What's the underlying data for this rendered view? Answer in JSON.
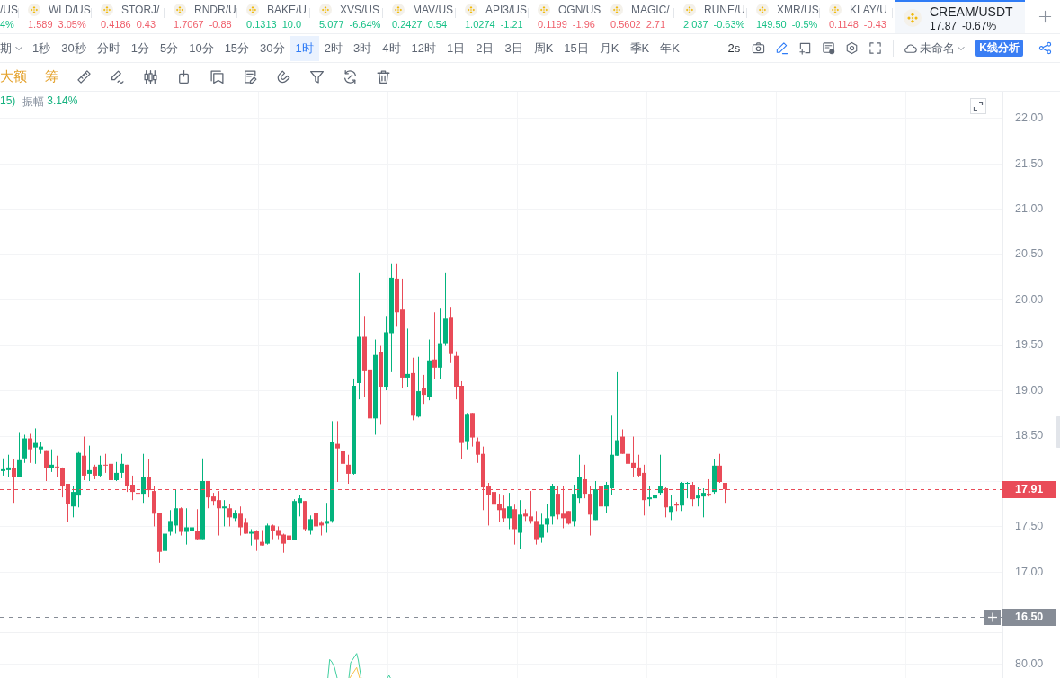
{
  "ticker": {
    "items": [
      {
        "kind": "partial",
        "symbol": "/US",
        "change": "4%",
        "color": "#16c086",
        "selected": false
      },
      {
        "kind": "full",
        "symbol": "WLD/US",
        "price": "1.589",
        "change": "3.05%",
        "color": "#ef5f6b",
        "selected": false
      },
      {
        "kind": "full",
        "symbol": "STORJ/",
        "price": "0.4186",
        "change": "0.43",
        "color": "#ef5f6b",
        "selected": false
      },
      {
        "kind": "full",
        "symbol": "RNDR/U",
        "price": "1.7067",
        "change": "-0.88",
        "color": "#ef5f6b",
        "selected": false
      },
      {
        "kind": "full",
        "symbol": "BAKE/U",
        "price": "0.1313",
        "change": "10.0",
        "color": "#16c086",
        "selected": false
      },
      {
        "kind": "full",
        "symbol": "XVS/US",
        "price": "5.077",
        "change": "-6.64%",
        "color": "#16c086",
        "selected": false
      },
      {
        "kind": "full",
        "symbol": "MAV/US",
        "price": "0.2427",
        "change": "0.54",
        "color": "#16c086",
        "selected": false
      },
      {
        "kind": "full",
        "symbol": "API3/US",
        "price": "1.0274",
        "change": "-1.21",
        "color": "#16c086",
        "selected": false
      },
      {
        "kind": "full",
        "symbol": "OGN/US",
        "price": "0.1199",
        "change": "-1.96",
        "color": "#ef5f6b",
        "selected": false
      },
      {
        "kind": "full",
        "symbol": "MAGIC/",
        "price": "0.5602",
        "change": "2.71",
        "color": "#ef5f6b",
        "selected": false
      },
      {
        "kind": "full",
        "symbol": "RUNE/U",
        "price": "2.037",
        "change": "-0.63%",
        "color": "#16c086",
        "selected": false
      },
      {
        "kind": "full",
        "symbol": "XMR/US",
        "price": "149.50",
        "change": "-0.5%",
        "color": "#16c086",
        "selected": false
      },
      {
        "kind": "full",
        "symbol": "KLAY/U",
        "price": "0.1148",
        "change": "-0.43",
        "color": "#ef5f6b",
        "selected": false
      },
      {
        "kind": "full",
        "symbol": "CREAM/USDT",
        "price": "17.87",
        "change": "-0.67%",
        "selected": true
      }
    ]
  },
  "timeframes": {
    "period": "期",
    "items": [
      {
        "label": "1秒",
        "selected": false
      },
      {
        "label": "30秒",
        "selected": false
      },
      {
        "label": "分时",
        "selected": false
      },
      {
        "label": "1分",
        "selected": false
      },
      {
        "label": "5分",
        "selected": false
      },
      {
        "label": "10分",
        "selected": false
      },
      {
        "label": "15分",
        "selected": false
      },
      {
        "label": "30分",
        "selected": false
      },
      {
        "label": "1时",
        "selected": true
      },
      {
        "label": "2时",
        "selected": false
      },
      {
        "label": "3时",
        "selected": false
      },
      {
        "label": "4时",
        "selected": false
      },
      {
        "label": "12时",
        "selected": false
      },
      {
        "label": "1日",
        "selected": false
      },
      {
        "label": "2日",
        "selected": false
      },
      {
        "label": "3日",
        "selected": false
      },
      {
        "label": "周K",
        "selected": false
      },
      {
        "label": "15日",
        "selected": false
      },
      {
        "label": "月K",
        "selected": false
      },
      {
        "label": "季K",
        "selected": false
      },
      {
        "label": "年K",
        "selected": false
      }
    ]
  },
  "chart_tools": {
    "interval": "2s",
    "layout_name": "未命名",
    "analysis_button": "K线分析"
  },
  "drawing_tools": {
    "buttons": [
      "大额",
      "筹"
    ]
  },
  "legend": {
    "value_tail": "15)",
    "amplitude_label": "振幅",
    "amplitude_value": "3.14%"
  },
  "chart": {
    "chart_data": [
      {
        "type": "candlestick",
        "grid": true,
        "ylim": [
          15.83,
          22.29
        ],
        "yticks": [
          {
            "value": 17,
            "label": "17.00"
          },
          {
            "value": 17.5,
            "label": "17.50"
          },
          {
            "value": 18.5,
            "label": "18.50"
          },
          {
            "value": 19,
            "label": "19.00"
          },
          {
            "value": 19.5,
            "label": "19.50"
          },
          {
            "value": 20,
            "label": "20.00"
          },
          {
            "value": 20.5,
            "label": "20.50"
          },
          {
            "value": 21,
            "label": "21.00"
          },
          {
            "value": 21.5,
            "label": "21.50"
          },
          {
            "value": 22,
            "label": "22.00"
          }
        ],
        "ref_lines": [
          {
            "axis": "y",
            "value": 17.91,
            "label": "17.91",
            "color": "#e94b58",
            "line_style": "dashed"
          },
          {
            "axis": "y",
            "value": 16.5,
            "label": "16.50",
            "color": "#868c96",
            "line_style": "dashed"
          }
        ],
        "categories": [
          null,
          null,
          null,
          null,
          null,
          null,
          null,
          null,
          null,
          null,
          null,
          null,
          null,
          null,
          null,
          null,
          null,
          null,
          null,
          null,
          null,
          null,
          null,
          null,
          null,
          null,
          null,
          null,
          null,
          null,
          null,
          null,
          null,
          null,
          null,
          null,
          null,
          null,
          null,
          null,
          null,
          null,
          null,
          null,
          null,
          null,
          null,
          null,
          null,
          null,
          null,
          null,
          null,
          null,
          null,
          null,
          null,
          null,
          null,
          null,
          null,
          null,
          null,
          null,
          null,
          null,
          null,
          null,
          null,
          null,
          null,
          null,
          null,
          null,
          null,
          null,
          null,
          null,
          null,
          null,
          null,
          null,
          null,
          null,
          null,
          null,
          null,
          null,
          null,
          null,
          null,
          null,
          null,
          null,
          null,
          null,
          null,
          null,
          null,
          null,
          null,
          null,
          null,
          null,
          null,
          null,
          null,
          null,
          null,
          null,
          null,
          null,
          null,
          null,
          null,
          null,
          null,
          null,
          null,
          null,
          null,
          null,
          null,
          null,
          null,
          null,
          null,
          null,
          null,
          null,
          null,
          null,
          null,
          null,
          null,
          null,
          null,
          null,
          null,
          null,
          null,
          null,
          null,
          null,
          null,
          null,
          null,
          null,
          null,
          null,
          null,
          null,
          null,
          null,
          null,
          null,
          null,
          null,
          null,
          null,
          null,
          null,
          null,
          null,
          null,
          null,
          null,
          null,
          null,
          null,
          null,
          null,
          null,
          null,
          null,
          null,
          null,
          null,
          null,
          null,
          null,
          null,
          null,
          null,
          null,
          null
        ],
        "ohlc": [
          [
            18.11,
            18.25,
            18.06,
            18.13
          ],
          [
            18.12,
            18.29,
            18.04,
            18.15
          ],
          [
            18.14,
            18.24,
            17.76,
            18.04
          ],
          [
            18.04,
            18.54,
            18.04,
            18.23
          ],
          [
            18.25,
            18.51,
            18.2,
            18.47
          ],
          [
            18.47,
            18.52,
            18.2,
            18.35
          ],
          [
            18.37,
            18.58,
            18.19,
            18.42
          ],
          [
            18.35,
            18.43,
            18.3,
            18.38
          ],
          [
            18.34,
            18.34,
            18.0,
            18.14
          ],
          [
            18.14,
            18.35,
            18.1,
            18.18
          ],
          [
            18.16,
            18.28,
            18.04,
            18.15
          ],
          [
            18.14,
            18.15,
            17.82,
            17.94
          ],
          [
            17.97,
            17.97,
            17.55,
            17.75
          ],
          [
            17.72,
            17.94,
            17.6,
            17.88
          ],
          [
            17.84,
            18.32,
            17.71,
            18.31
          ],
          [
            18.28,
            18.49,
            18.01,
            18.06
          ],
          [
            18.08,
            18.39,
            18.0,
            18.12
          ],
          [
            18.16,
            18.18,
            18.02,
            18.06
          ],
          [
            18.06,
            18.28,
            18.05,
            18.18
          ],
          [
            18.18,
            18.3,
            18.09,
            18.17
          ],
          [
            18.19,
            18.26,
            17.95,
            18.01
          ],
          [
            18.01,
            18.21,
            18.0,
            18.09
          ],
          [
            18.09,
            18.3,
            18.03,
            18.19
          ],
          [
            18.18,
            18.18,
            17.88,
            17.95
          ],
          [
            17.96,
            18.06,
            17.79,
            17.88
          ],
          [
            17.87,
            17.99,
            17.65,
            17.86
          ],
          [
            17.86,
            18.3,
            17.76,
            18.04
          ],
          [
            18.04,
            18.24,
            17.82,
            17.9
          ],
          [
            17.89,
            17.95,
            17.5,
            17.64
          ],
          [
            17.65,
            17.65,
            17.1,
            17.22
          ],
          [
            17.23,
            17.7,
            17.19,
            17.42
          ],
          [
            17.44,
            17.68,
            17.4,
            17.56
          ],
          [
            17.51,
            17.91,
            17.42,
            17.7
          ],
          [
            17.7,
            17.71,
            17.4,
            17.44
          ],
          [
            17.44,
            17.7,
            17.3,
            17.49
          ],
          [
            17.45,
            17.54,
            17.12,
            17.49
          ],
          [
            17.45,
            17.69,
            17.35,
            17.36
          ],
          [
            17.36,
            18.25,
            17.36,
            18.0
          ],
          [
            18.0,
            18.0,
            17.7,
            17.82
          ],
          [
            17.83,
            17.87,
            17.73,
            17.78
          ],
          [
            17.79,
            17.89,
            17.4,
            17.7
          ],
          [
            17.7,
            17.79,
            17.5,
            17.72
          ],
          [
            17.7,
            17.75,
            17.5,
            17.6
          ],
          [
            17.59,
            17.68,
            17.56,
            17.65
          ],
          [
            17.64,
            17.72,
            17.4,
            17.49
          ],
          [
            17.54,
            17.59,
            17.42,
            17.42
          ],
          [
            17.42,
            17.47,
            17.29,
            17.44
          ],
          [
            17.45,
            17.46,
            17.23,
            17.36
          ],
          [
            17.33,
            17.46,
            17.29,
            17.29
          ],
          [
            17.31,
            17.53,
            17.3,
            17.51
          ],
          [
            17.51,
            17.52,
            17.36,
            17.45
          ],
          [
            17.46,
            17.5,
            17.36,
            17.4
          ],
          [
            17.41,
            17.42,
            17.21,
            17.31
          ],
          [
            17.4,
            17.44,
            17.23,
            17.35
          ],
          [
            17.35,
            17.8,
            17.35,
            17.78
          ],
          [
            17.76,
            17.85,
            17.61,
            17.81
          ],
          [
            17.78,
            17.78,
            17.45,
            17.47
          ],
          [
            17.46,
            17.62,
            17.41,
            17.58
          ],
          [
            17.65,
            17.67,
            17.5,
            17.5
          ],
          [
            17.54,
            17.56,
            17.4,
            17.51
          ],
          [
            17.53,
            17.76,
            17.43,
            17.56
          ],
          [
            17.56,
            18.66,
            17.54,
            18.43
          ],
          [
            18.41,
            18.66,
            17.99,
            18.36
          ],
          [
            18.33,
            18.46,
            18.13,
            18.19
          ],
          [
            18.18,
            18.29,
            17.97,
            18.08
          ],
          [
            18.08,
            19.13,
            18.07,
            19.05
          ],
          [
            19.08,
            20.29,
            18.9,
            19.59
          ],
          [
            19.59,
            19.82,
            18.93,
            19.21
          ],
          [
            19.23,
            19.23,
            18.53,
            18.69
          ],
          [
            18.69,
            19.56,
            18.51,
            19.39
          ],
          [
            19.42,
            19.49,
            18.62,
            19.04
          ],
          [
            19.04,
            19.82,
            19.0,
            19.64
          ],
          [
            19.63,
            20.39,
            19.2,
            20.24
          ],
          [
            20.23,
            20.39,
            19.7,
            19.86
          ],
          [
            19.89,
            20.23,
            19.02,
            19.14
          ],
          [
            19.14,
            19.68,
            19.04,
            19.18
          ],
          [
            19.19,
            19.36,
            18.67,
            18.72
          ],
          [
            18.71,
            19.37,
            18.7,
            18.99
          ],
          [
            19.02,
            19.17,
            18.85,
            18.95
          ],
          [
            18.93,
            19.56,
            18.89,
            19.33
          ],
          [
            19.34,
            19.86,
            19.12,
            19.25
          ],
          [
            19.25,
            19.9,
            19.12,
            19.51
          ],
          [
            19.51,
            20.29,
            19.49,
            19.79
          ],
          [
            19.8,
            19.92,
            19.3,
            19.4
          ],
          [
            19.38,
            19.43,
            18.9,
            19.04
          ],
          [
            19.05,
            19.1,
            18.24,
            18.42
          ],
          [
            18.44,
            18.75,
            18.35,
            18.74
          ],
          [
            18.75,
            18.75,
            18.38,
            18.48
          ],
          [
            18.44,
            18.48,
            18.2,
            18.29
          ],
          [
            18.3,
            18.38,
            17.68,
            17.93
          ],
          [
            17.94,
            17.98,
            17.51,
            17.85
          ],
          [
            17.88,
            17.97,
            17.62,
            17.74
          ],
          [
            17.75,
            17.86,
            17.55,
            17.68
          ],
          [
            17.7,
            17.84,
            17.55,
            17.59
          ],
          [
            17.59,
            17.87,
            17.47,
            17.72
          ],
          [
            17.69,
            17.74,
            17.3,
            17.47
          ],
          [
            17.43,
            17.79,
            17.25,
            17.63
          ],
          [
            17.64,
            17.69,
            17.56,
            17.61
          ],
          [
            17.61,
            17.89,
            17.53,
            17.56
          ],
          [
            17.56,
            17.67,
            17.3,
            17.36
          ],
          [
            17.38,
            17.64,
            17.32,
            17.52
          ],
          [
            17.52,
            17.75,
            17.43,
            17.59
          ],
          [
            17.61,
            17.97,
            17.52,
            17.95
          ],
          [
            17.86,
            17.95,
            17.58,
            17.63
          ],
          [
            17.64,
            17.95,
            17.48,
            17.59
          ],
          [
            17.67,
            17.67,
            17.52,
            17.53
          ],
          [
            17.56,
            17.96,
            17.5,
            17.86
          ],
          [
            17.81,
            18.29,
            17.76,
            18.04
          ],
          [
            18.02,
            18.18,
            17.81,
            17.86
          ],
          [
            17.86,
            17.95,
            17.4,
            17.63
          ],
          [
            17.57,
            18.0,
            17.57,
            17.91
          ],
          [
            17.94,
            17.99,
            17.65,
            17.72
          ],
          [
            17.72,
            17.99,
            17.65,
            17.96
          ],
          [
            17.92,
            18.72,
            17.85,
            18.29
          ],
          [
            18.28,
            19.2,
            18.28,
            18.45
          ],
          [
            18.49,
            18.57,
            18.3,
            18.3
          ],
          [
            18.3,
            18.43,
            18.0,
            18.19
          ],
          [
            18.2,
            18.49,
            18.05,
            18.14
          ],
          [
            18.15,
            18.29,
            18.04,
            18.06
          ],
          [
            18.09,
            18.18,
            17.62,
            17.79
          ],
          [
            17.8,
            17.95,
            17.72,
            17.82
          ],
          [
            17.81,
            17.89,
            17.72,
            17.85
          ],
          [
            17.87,
            18.29,
            17.85,
            17.94
          ],
          [
            17.92,
            17.93,
            17.6,
            17.71
          ],
          [
            17.66,
            17.85,
            17.57,
            17.72
          ],
          [
            17.75,
            17.77,
            17.67,
            17.73
          ],
          [
            17.73,
            17.99,
            17.67,
            17.98
          ],
          [
            17.97,
            17.99,
            17.81,
            17.98
          ],
          [
            17.96,
            17.99,
            17.72,
            17.8
          ],
          [
            17.81,
            17.93,
            17.72,
            17.84
          ],
          [
            17.83,
            17.92,
            17.6,
            17.87
          ],
          [
            17.86,
            18.02,
            17.83,
            17.84
          ],
          [
            17.88,
            18.24,
            17.86,
            18.17
          ],
          [
            18.17,
            18.3,
            17.98,
            17.99
          ],
          [
            17.98,
            17.98,
            17.76,
            17.91
          ],
          null,
          null,
          null,
          null,
          null,
          null,
          null,
          null,
          null,
          null,
          null,
          null,
          null,
          null,
          null,
          null,
          null,
          null,
          null,
          null,
          null,
          null,
          null,
          null,
          null,
          null,
          null,
          null,
          null,
          null,
          null,
          null,
          null,
          null,
          null,
          null,
          null,
          null,
          null,
          null,
          null,
          null,
          null,
          null,
          null,
          null,
          null,
          null,
          null,
          null,
          null
        ]
      }
    ],
    "indicator_pane": {
      "tick_label": "80.00"
    }
  }
}
